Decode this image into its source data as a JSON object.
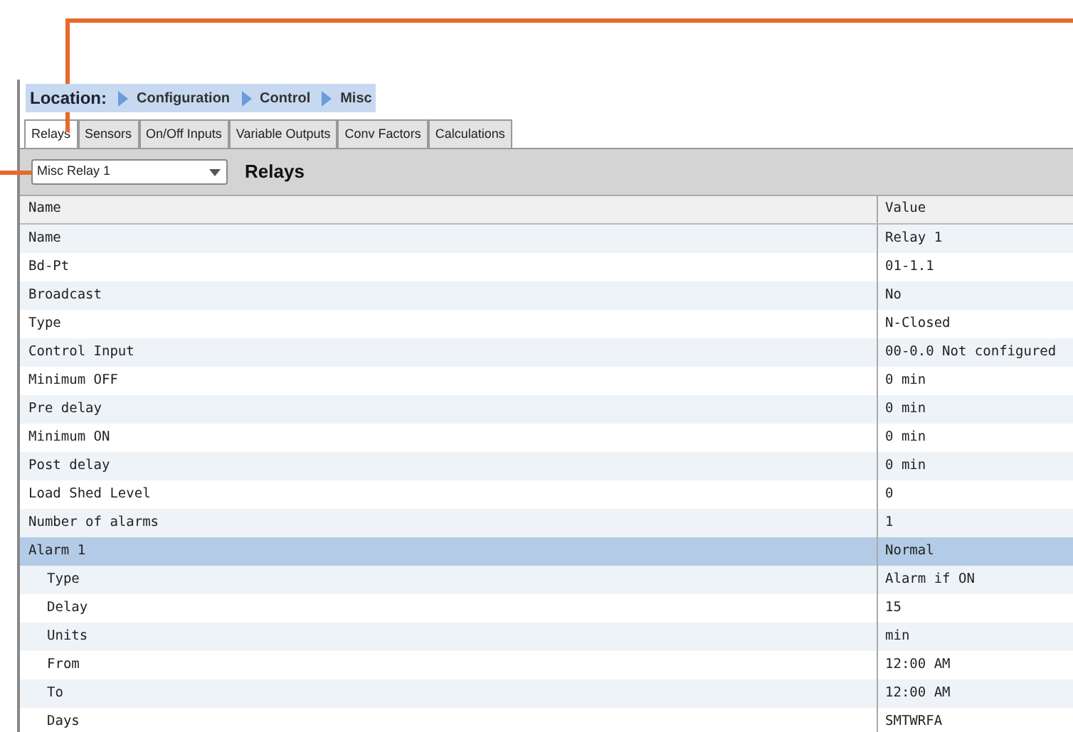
{
  "location": {
    "label": "Location:",
    "crumbs": [
      "Configuration",
      "Control",
      "Misc"
    ]
  },
  "tabs": [
    {
      "label": "Relays",
      "selected": true
    },
    {
      "label": "Sensors",
      "selected": false
    },
    {
      "label": "On/Off Inputs",
      "selected": false
    },
    {
      "label": "Variable Outputs",
      "selected": false
    },
    {
      "label": "Conv Factors",
      "selected": false
    },
    {
      "label": "Calculations",
      "selected": false
    }
  ],
  "toolbar": {
    "dropdown": {
      "value": "Misc Relay 1"
    },
    "title": "Relays"
  },
  "table": {
    "columns": [
      "Name",
      "Value"
    ],
    "rows": [
      {
        "name": "Name",
        "value": "Relay 1",
        "selected": false
      },
      {
        "name": "Bd-Pt",
        "value": "01-1.1",
        "selected": false
      },
      {
        "name": "Broadcast",
        "value": "No",
        "selected": false
      },
      {
        "name": "Type",
        "value": "N-Closed",
        "selected": false
      },
      {
        "name": "Control Input",
        "value": "00-0.0 Not configured",
        "selected": false
      },
      {
        "name": "Minimum OFF",
        "value": "0 min",
        "selected": false
      },
      {
        "name": "Pre delay",
        "value": "0 min",
        "selected": false
      },
      {
        "name": "Minimum ON",
        "value": "0 min",
        "selected": false
      },
      {
        "name": "Post delay",
        "value": "0 min",
        "selected": false
      },
      {
        "name": "Load Shed Level",
        "value": "0",
        "selected": false
      },
      {
        "name": "Number of alarms",
        "value": "1",
        "selected": false
      },
      {
        "name": "Alarm 1",
        "value": "Normal",
        "selected": true,
        "children": [
          {
            "name": "Type",
            "value": "Alarm if ON",
            "selected": false
          },
          {
            "name": "Delay",
            "value": "15",
            "selected": false
          },
          {
            "name": "Units",
            "value": "min",
            "selected": false
          },
          {
            "name": "From",
            "value": "12:00 AM",
            "selected": false
          },
          {
            "name": "To",
            "value": "12:00 AM",
            "selected": false
          },
          {
            "name": "Days",
            "value": "SMTWRFA",
            "selected": false
          }
        ]
      }
    ]
  }
}
